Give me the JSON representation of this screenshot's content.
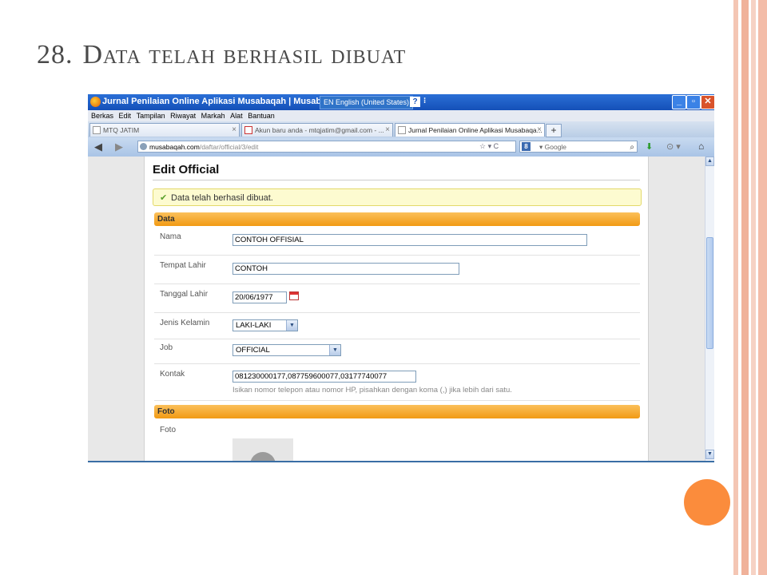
{
  "slide": {
    "number": "28.",
    "title": "Data telah berhasil dibuat"
  },
  "colors": {
    "accent_orange": "#fb8c3c",
    "section_bar": "#f5a623",
    "titlebar_blue": "#1f5fc8"
  },
  "browser": {
    "window_title": "Jurnal Penilaian Online Aplikasi Musabaqah | Musabaqah",
    "language": "EN English (United States)",
    "help_label": "?",
    "options_label": "⁝",
    "window_buttons": {
      "minimize": "_",
      "maximize": "▫",
      "close": "✕"
    },
    "menu": [
      "Berkas",
      "Edit",
      "Tampilan",
      "Riwayat",
      "Markah",
      "Alat",
      "Bantuan"
    ],
    "tabs": [
      {
        "label": "MTQ JATIM",
        "icon": "site-icon",
        "close": "×"
      },
      {
        "label": "Akun baru anda - mtqjatim@gmail.com - ...",
        "icon": "gmail-icon",
        "close": "×"
      },
      {
        "label": "Jurnal Penilaian Online Aplikasi Musabaqa...",
        "icon": "page-icon",
        "close": "×"
      }
    ],
    "new_tab": "+",
    "back": "◀",
    "forward": "▶",
    "url_host": "musabaqah.com",
    "url_path": "/daftar/official/3/edit",
    "url_tools": "☆ ▾ C",
    "search_engine_label": "8",
    "search_placeholder": "▾ Google",
    "search_icon": "⌕",
    "toolbar_icons": {
      "download": "⬇",
      "addon": "⊙ ▾",
      "home": "⌂"
    }
  },
  "page": {
    "title": "Edit Official",
    "success_message": "Data telah berhasil dibuat.",
    "check_icon": "✔",
    "sections": {
      "data": "Data",
      "foto": "Foto"
    },
    "fields": {
      "nama": {
        "label": "Nama",
        "value": "CONTOH OFFISIAL"
      },
      "tempat_lahir": {
        "label": "Tempat Lahir",
        "value": "CONTOH"
      },
      "tanggal_lahir": {
        "label": "Tanggal Lahir",
        "value": "20/06/1977"
      },
      "jenis_kelamin": {
        "label": "Jenis Kelamin",
        "value": "LAKI-LAKI"
      },
      "job": {
        "label": "Job",
        "value": "OFFICIAL"
      },
      "kontak": {
        "label": "Kontak",
        "value": "081230000177,087759600077,03177740077",
        "hint": "Isikan nomor telepon atau nomor HP, pisahkan dengan koma (,) jika lebih dari satu."
      },
      "foto": {
        "label": "Foto"
      }
    },
    "select_arrow": "▼",
    "scroll_up": "▲",
    "scroll_down": "▼"
  }
}
